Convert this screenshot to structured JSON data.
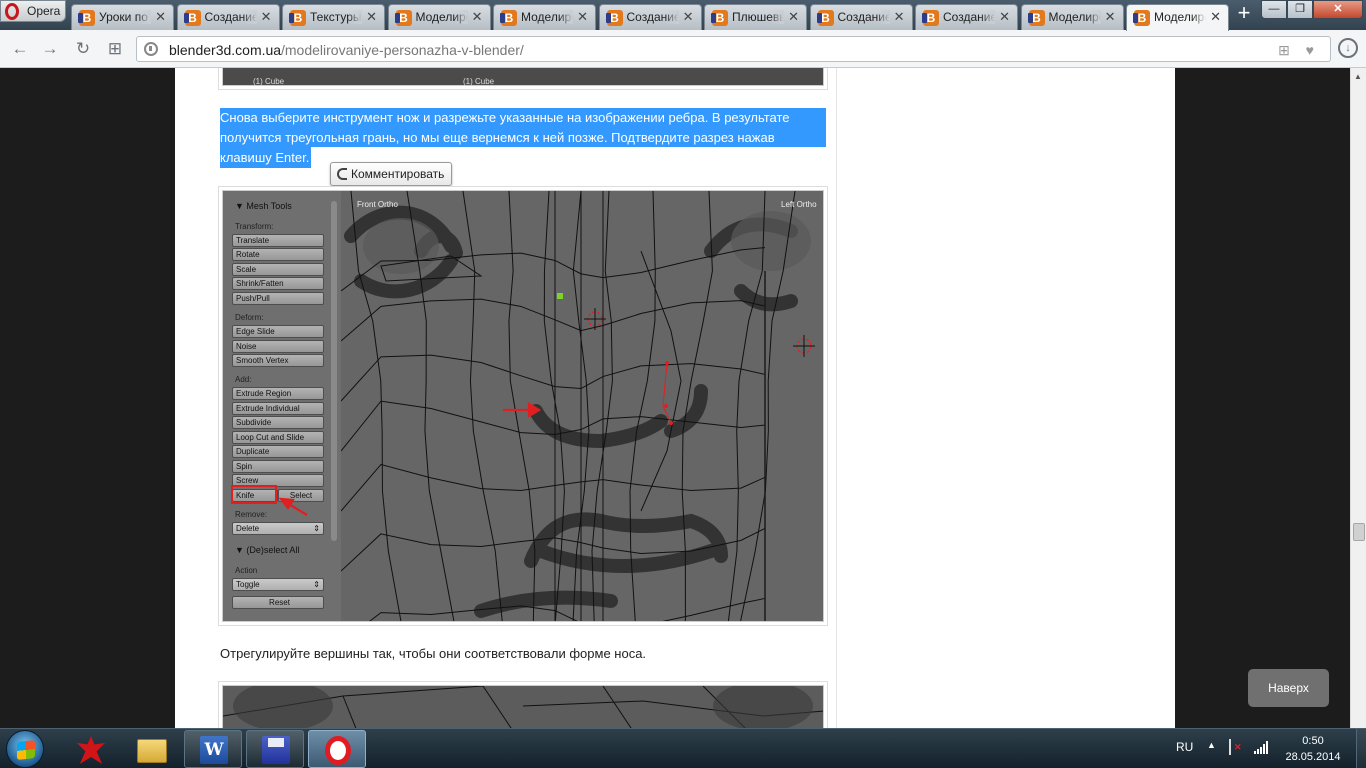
{
  "browser": {
    "menu_label": "Opera",
    "tabs": [
      {
        "label": "Уроки по созданию",
        "active": false
      },
      {
        "label": "Создание персонажа",
        "active": false
      },
      {
        "label": "Текстуры в Blender",
        "active": false
      },
      {
        "label": "Моделирование",
        "active": false
      },
      {
        "label": "Моделирование",
        "active": false
      },
      {
        "label": "Создание персонажа",
        "active": false
      },
      {
        "label": "Плюшевый мишка",
        "active": false
      },
      {
        "label": "Создание персонажа",
        "active": false
      },
      {
        "label": "Создание персонажа",
        "active": false
      },
      {
        "label": "Моделирование",
        "active": false
      },
      {
        "label": "Моделирование",
        "active": true
      }
    ],
    "new_tab": "+",
    "window_controls": {
      "minimize": "—",
      "maximize": "❐",
      "close": "✕"
    }
  },
  "navbar": {
    "back": "←",
    "forward": "→",
    "reload": "↻",
    "speed_dial": "⊞",
    "url_host": "blender3d.com.ua",
    "url_path": "/modelirovaniye-personazha-v-blender/",
    "url_tools": "⊞ ♥",
    "download": "↓"
  },
  "article": {
    "top_image_captions": [
      "(1) Cube",
      "(1) Cube"
    ],
    "selected_paragraph": "Снова выберите инструмент нож и разрежьте указанные на изображении ребра. В результате получится треугольная грань, но мы еще вернемся к ней позже. Подтвердите разрез нажав клавишу Enter.",
    "comment_button": "Комментировать",
    "paragraph2": "Отрегулируйте вершины так, чтобы они соответствовали форме носа."
  },
  "blender": {
    "panel_title": "▼ Mesh Tools",
    "transform_label": "Transform:",
    "transform_buttons": [
      "Translate",
      "Rotate",
      "Scale",
      "Shrink/Fatten",
      "Push/Pull"
    ],
    "deform_label": "Deform:",
    "deform_buttons": [
      "Edge Slide",
      "Noise",
      "Smooth Vertex"
    ],
    "add_label": "Add:",
    "add_buttons": [
      "Extrude Region",
      "Extrude Individual",
      "Subdivide",
      "Loop Cut and Slide",
      "Duplicate",
      "Spin",
      "Screw"
    ],
    "knife": "Knife",
    "select": "Select",
    "remove_label": "Remove:",
    "remove_value": "Delete",
    "deselect_title": "▼ (De)select All",
    "action_label": "Action",
    "action_value": "Toggle",
    "reset": "Reset",
    "view_left": "Front Ortho",
    "view_right": "Left Ortho"
  },
  "back_to_top": "Наверх",
  "taskbar": {
    "apps": [
      "red-app",
      "file-explorer",
      "word",
      "save-app",
      "opera"
    ],
    "word_letter": "W",
    "lang": "RU",
    "tray_arrow": "▲",
    "time": "0:50",
    "date": "28.05.2014"
  },
  "colors": {
    "selection": "#3399ff",
    "knife_highlight": "#e02020",
    "tab_favicon": "#e2791d"
  }
}
